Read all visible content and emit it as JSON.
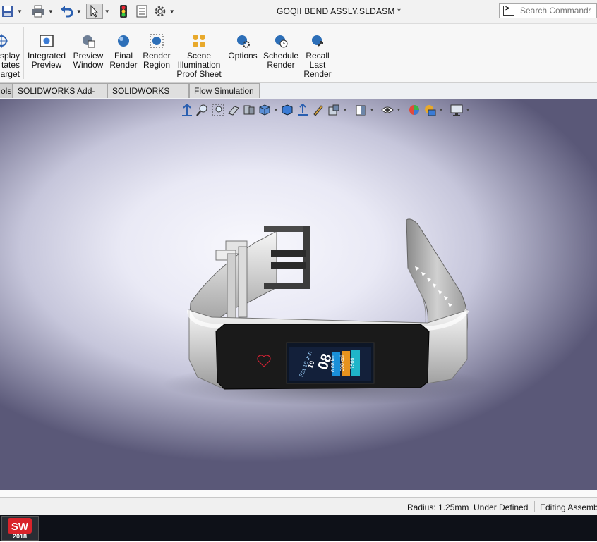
{
  "app": {
    "document_title": "GOQII BEND ASSLY.SLDASM *",
    "search_placeholder": "Search Commands"
  },
  "quick_access": [
    "save-icon",
    "print-icon",
    "undo-icon",
    "select-icon",
    "rebuild-icon",
    "file-properties-icon",
    "options-icon"
  ],
  "ribbon": {
    "partial_button": [
      "splay",
      "tates",
      "arget"
    ],
    "buttons": [
      {
        "name": "integrated-preview",
        "lines": [
          "Integrated",
          "Preview"
        ]
      },
      {
        "name": "preview-window",
        "lines": [
          "Preview",
          "Window"
        ]
      },
      {
        "name": "final-render",
        "lines": [
          "Final",
          "Render"
        ]
      },
      {
        "name": "render-region",
        "lines": [
          "Render",
          "Region"
        ]
      },
      {
        "name": "scene-illumination-proof-sheet",
        "lines": [
          "Scene",
          "Illumination",
          "Proof Sheet"
        ]
      },
      {
        "name": "options",
        "lines": [
          "Options"
        ]
      },
      {
        "name": "schedule-render",
        "lines": [
          "Schedule",
          "Render"
        ]
      },
      {
        "name": "recall-last-render",
        "lines": [
          "Recall",
          "Last",
          "Render"
        ]
      }
    ]
  },
  "tabs": [
    "ols",
    "SOLIDWORKS Add-Ins",
    "SOLIDWORKS MBD",
    "Flow Simulation"
  ],
  "view_toolbar": [
    "zoom-to-fit-icon",
    "zoom-to-area-icon",
    "previous-view-icon",
    "section-view-icon",
    "dynamic-annotation-views-icon",
    "view-orientation-icon",
    "display-style-icon",
    "hide-show-items-icon",
    "edit-appearance-icon",
    "apply-scene-icon",
    "view-settings-icon"
  ],
  "watch_screen": {
    "date": "Sat 16 Jun",
    "time_hour": "10",
    "time_min": "08",
    "stat1": "6.08 km",
    "stat2": "398 cal",
    "stat3": "7566"
  },
  "statusbar": {
    "radius": "Radius: 1.25mm",
    "state": "Under Defined",
    "mode": "Editing Assemb"
  },
  "taskbar": {
    "app_logo_text": "SW",
    "app_year": "2018"
  }
}
